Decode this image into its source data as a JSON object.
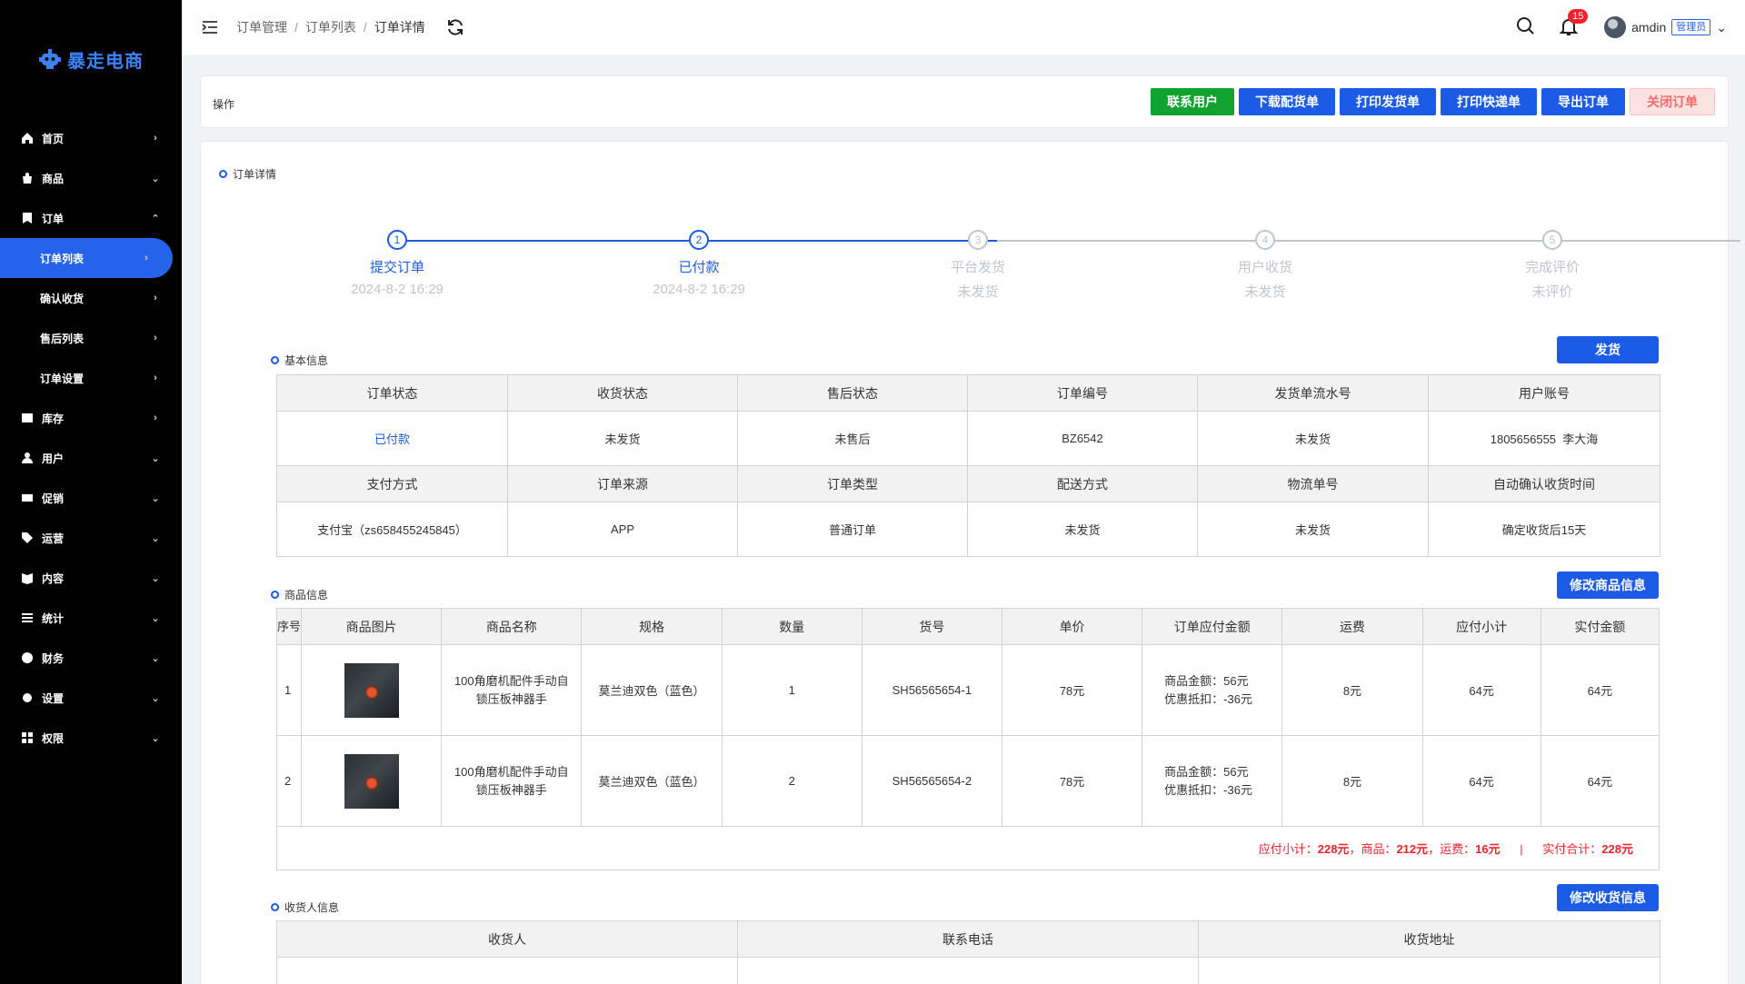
{
  "app": {
    "name": "暴走电商"
  },
  "sidebar": {
    "items": [
      {
        "label": "首页",
        "icon": "home-icon",
        "arrow": "›"
      },
      {
        "label": "商品",
        "icon": "goods-icon",
        "arrow": "⌄"
      },
      {
        "label": "订单",
        "icon": "order-icon",
        "arrow": "⌃"
      },
      {
        "label": "订单列表",
        "arrow": "›",
        "sub": true,
        "active": true
      },
      {
        "label": "确认收货",
        "arrow": "›",
        "sub": true
      },
      {
        "label": "售后列表",
        "arrow": "›",
        "sub": true
      },
      {
        "label": "订单设置",
        "arrow": "›",
        "sub": true
      },
      {
        "label": "库存",
        "icon": "inventory-icon",
        "arrow": "›"
      },
      {
        "label": "用户",
        "icon": "user-icon",
        "arrow": "⌄"
      },
      {
        "label": "促销",
        "icon": "promotion-icon",
        "arrow": "⌄"
      },
      {
        "label": "运营",
        "icon": "tag-icon",
        "arrow": "⌄"
      },
      {
        "label": "内容",
        "icon": "content-icon",
        "arrow": "⌄"
      },
      {
        "label": "统计",
        "icon": "stats-icon",
        "arrow": "⌄"
      },
      {
        "label": "财务",
        "icon": "finance-icon",
        "arrow": "⌄"
      },
      {
        "label": "设置",
        "icon": "settings-icon",
        "arrow": "⌄"
      },
      {
        "label": "权限",
        "icon": "permission-icon",
        "arrow": "⌄"
      }
    ]
  },
  "header": {
    "breadcrumb": [
      "订单管理",
      "订单列表",
      "订单详情"
    ],
    "notifications": "15",
    "username": "amdin",
    "role": "管理员"
  },
  "actions": {
    "label": "操作",
    "buttons": [
      {
        "label": "联系用户",
        "style": "green"
      },
      {
        "label": "下载配货单",
        "style": "blue"
      },
      {
        "label": "打印发货单",
        "style": "blue"
      },
      {
        "label": "打印快递单",
        "style": "blue"
      },
      {
        "label": "导出订单",
        "style": "blue"
      },
      {
        "label": "关闭订单",
        "style": "pink"
      }
    ]
  },
  "detail": {
    "title": "订单详情",
    "steps": [
      {
        "num": "1",
        "title": "提交订单",
        "desc": "2024-8-2 16:29",
        "done": true
      },
      {
        "num": "2",
        "title": "已付款",
        "desc": "2024-8-2 16:29",
        "done": true
      },
      {
        "num": "3",
        "title": "平台发货",
        "desc": "未发货",
        "done": false
      },
      {
        "num": "4",
        "title": "用户收货",
        "desc": "未发货",
        "done": false
      },
      {
        "num": "5",
        "title": "完成评价",
        "desc": "未评价",
        "done": false
      }
    ]
  },
  "basic": {
    "title": "基本信息",
    "ship_button": "发货",
    "headers1": [
      "订单状态",
      "收货状态",
      "售后状态",
      "订单编号",
      "发货单流水号",
      "用户账号"
    ],
    "values1": [
      "已付款",
      "未发货",
      "未售后",
      "BZ6542",
      "未发货",
      "1805656555  李大海"
    ],
    "headers2": [
      "支付方式",
      "订单来源",
      "订单类型",
      "配送方式",
      "物流单号",
      "自动确认收货时间"
    ],
    "values2": [
      "支付宝（zs658455245845）",
      "APP",
      "普通订单",
      "未发货",
      "未发货",
      "确定收货后15天"
    ]
  },
  "goods": {
    "title": "商品信息",
    "edit_button": "修改商品信息",
    "headers": [
      "序号",
      "商品图片",
      "商品名称",
      "规格",
      "数量",
      "货号",
      "单价",
      "订单应付金额",
      "运费",
      "应付小计",
      "实付金额"
    ],
    "rows": [
      {
        "idx": "1",
        "name": "100角磨机配件手动自锁压板神器手",
        "spec": "莫兰迪双色（蓝色）",
        "qty": "1",
        "sku": "SH56565654-1",
        "price": "78元",
        "amount1": "商品金额：56元",
        "amount2": "优惠抵扣：-36元",
        "freight": "8元",
        "subtotal": "64元",
        "paid": "64元"
      },
      {
        "idx": "2",
        "name": "100角磨机配件手动自锁压板神器手",
        "spec": "莫兰迪双色（蓝色）",
        "qty": "2",
        "sku": "SH56565654-2",
        "price": "78元",
        "amount1": "商品金额：56元",
        "amount2": "优惠抵扣：-36元",
        "freight": "8元",
        "subtotal": "64元",
        "paid": "64元"
      }
    ],
    "summary": {
      "due_label": "应付小计：",
      "due_value": "228元",
      "goods_label": "，商品：",
      "goods_value": "212元",
      "freight_label": "，运费：",
      "freight_value": "16元",
      "divider": "|",
      "paid_label": "实付合计：",
      "paid_value": "228元"
    }
  },
  "receiver": {
    "title": "收货人信息",
    "edit_button": "修改收货信息",
    "headers": [
      "收货人",
      "联系电话",
      "收货地址"
    ]
  },
  "colors": {
    "primary": "#1c5be6",
    "green": "#10a32f",
    "danger": "#f5222d",
    "sidebar": "#000000"
  }
}
